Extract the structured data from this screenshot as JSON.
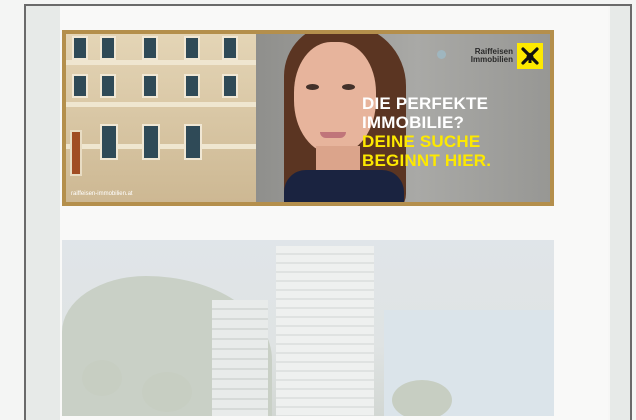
{
  "ad": {
    "headline_line1": "DIE PERFEKTE",
    "headline_line2": "IMMOBILIE?",
    "headline_line3": "DEINE SUCHE",
    "headline_line4": "BEGINNT HIER.",
    "brand_line1": "Raiffeisen",
    "brand_line2": "Immobilien",
    "url": "raiffeisen-immobilien.at",
    "colors": {
      "accent_yellow": "#fde900",
      "frame_gold": "#b48f4c",
      "headline_white": "#ffffff"
    }
  },
  "icons": {
    "brand_logo": "raiffeisen-gable-cross-icon"
  }
}
